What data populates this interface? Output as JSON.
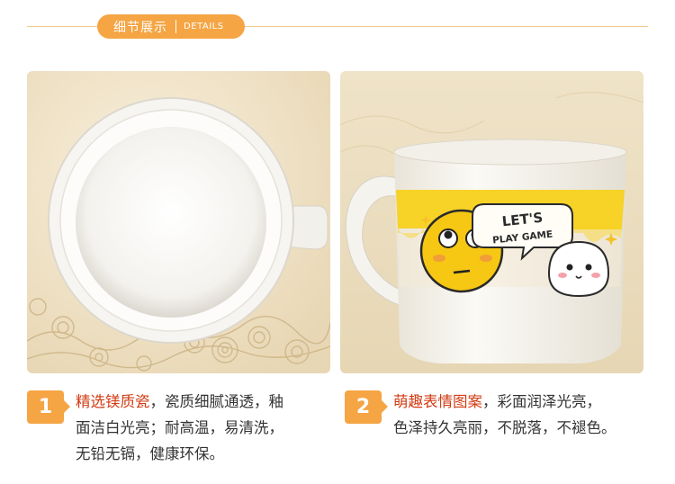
{
  "header": {
    "title": "细节展示",
    "subtitle": "DETAILS"
  },
  "features": [
    {
      "number": "1",
      "highlight": "精选镁质瓷",
      "line1_rest": "，瓷质细腻通透，釉",
      "line2": "面洁白光亮；耐高温，易清洗，",
      "line3": "无铅无镉，健康环保。"
    },
    {
      "number": "2",
      "highlight": "萌趣表情图案",
      "line1_rest": "，彩面润泽光亮，",
      "line2": "色泽持久亮丽，不脱落，不褪色。"
    }
  ],
  "mug_print": {
    "line1": "LET'S",
    "line2": "PLAY GAME"
  },
  "colors": {
    "accent": "#f5a544",
    "highlight": "#d23b13",
    "mug_yellow": "#f7d227"
  }
}
